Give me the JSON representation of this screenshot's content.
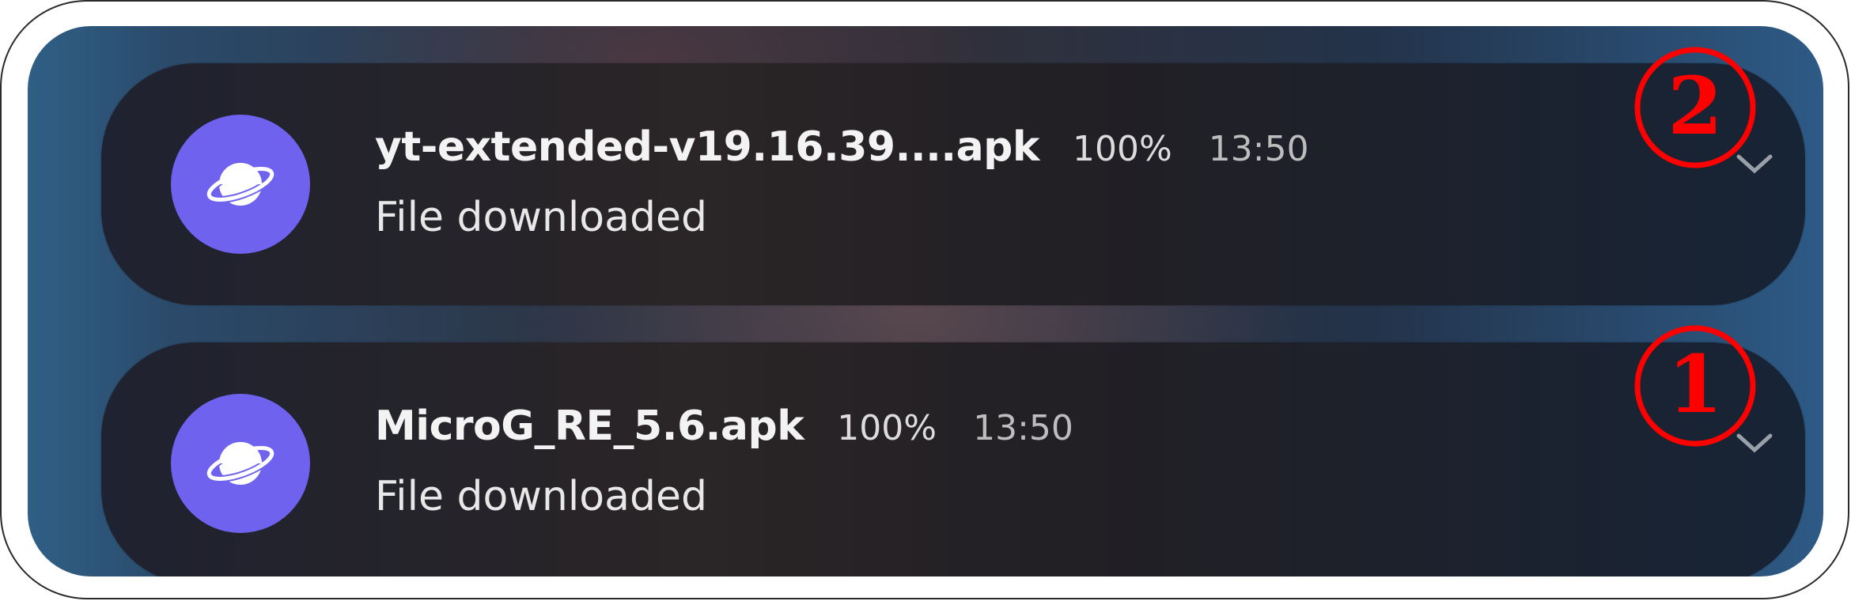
{
  "notifications": [
    {
      "app_icon": "browser-planet-icon",
      "filename": "yt-extended-v19.16.39....apk",
      "progress": "100%",
      "time": "13:50",
      "status": "File downloaded",
      "step_badge": "2"
    },
    {
      "app_icon": "browser-planet-icon",
      "filename": "MicroG_RE_5.6.apk",
      "progress": "100%",
      "time": "13:50",
      "status": "File downloaded",
      "step_badge": "1"
    }
  ],
  "colors": {
    "icon_background": "#6e62ee",
    "annotation_red": "#ff0000"
  }
}
